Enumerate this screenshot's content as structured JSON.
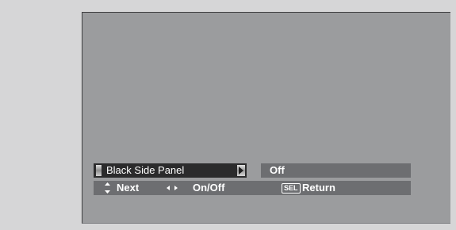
{
  "menu": {
    "item_label": "Black Side Panel",
    "value": "Off"
  },
  "help": {
    "updown_icon": "up-down-arrows-icon",
    "next_label": "Next",
    "leftright_icon": "left-right-arrows-icon",
    "onoff_label": "On/Off",
    "sel_key": "SEL",
    "return_label": "Return"
  },
  "colors": {
    "background": "#d6d6d7",
    "screen": "#9b9c9e",
    "selected_item": "#2b2b2c",
    "panel": "#6d6e71",
    "text": "#ffffff"
  }
}
